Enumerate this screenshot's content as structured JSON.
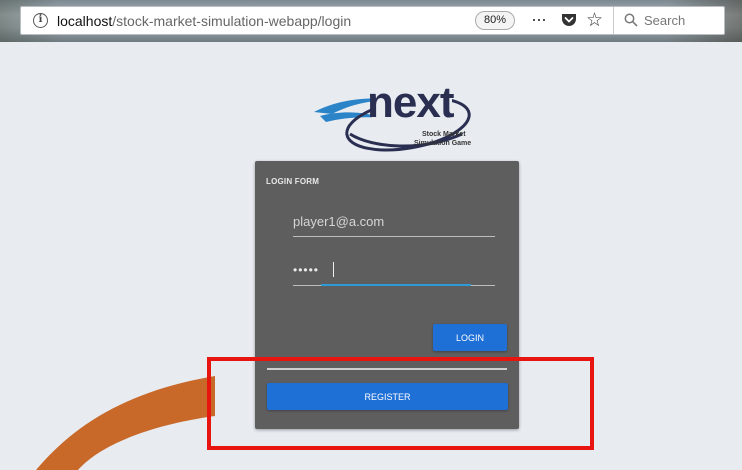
{
  "browser": {
    "url_host": "localhost",
    "url_path": "/stock-market-simulation-webapp/login",
    "zoom": "80%",
    "more_glyph": "···",
    "search_placeholder": "Search"
  },
  "logo": {
    "word": "next",
    "subtitle_line1": "Stock Market",
    "subtitle_line2": "Simulation Game"
  },
  "login_form": {
    "title": "LOGIN FORM",
    "email_value": "player1@a.com",
    "password_value": "•••••",
    "login_label": "LOGIN",
    "register_label": "REGISTER"
  },
  "colors": {
    "page_bg": "#e8ecf1",
    "card_bg": "#5e5e5e",
    "button_blue": "#1e6fd6",
    "focus_line": "#2e9ad6",
    "swoosh_orange": "#c8692a",
    "highlight_red": "#e8140f"
  }
}
